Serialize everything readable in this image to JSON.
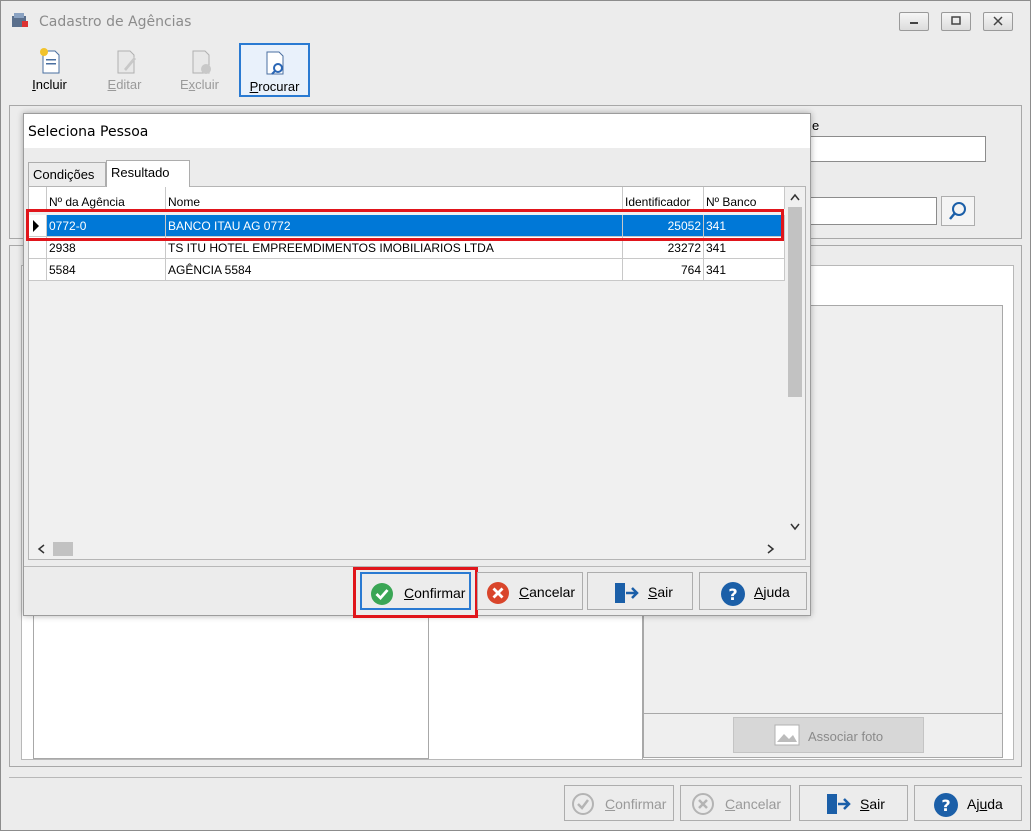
{
  "window": {
    "title": "Cadastro de Agências"
  },
  "toolbar": {
    "incluir": {
      "label_u": "I",
      "label_rest": "ncluir"
    },
    "editar": {
      "label_u": "E",
      "label_rest": "ditar"
    },
    "excluir_pre": "E",
    "excluir_u": "x",
    "excluir_rest": "cluir",
    "procurar": {
      "label_u": "P",
      "label_rest": "rocurar"
    }
  },
  "background_form": {
    "label_fragment": "e",
    "associar_foto": "Associar foto"
  },
  "dialog": {
    "title": "Seleciona Pessoa",
    "tabs": [
      {
        "label": "Condições"
      },
      {
        "label": "Resultado"
      }
    ],
    "columns": [
      "Nº da Agência",
      "Nome",
      "Identificador",
      "Nº Banco"
    ],
    "rows": [
      {
        "agencia": "0772-0",
        "nome": "BANCO ITAU AG 0772",
        "identificador": "25052",
        "banco": "341"
      },
      {
        "agencia": "2938",
        "nome": "TS ITU HOTEL EMPREEMDIMENTOS IMOBILIARIOS LTDA",
        "identificador": "23272",
        "banco": "341"
      },
      {
        "agencia": "5584",
        "nome": "AGÊNCIA 5584",
        "identificador": "764",
        "banco": "341"
      }
    ],
    "buttons": {
      "confirmar": {
        "u": "C",
        "rest": "onfirmar"
      },
      "cancelar": {
        "u": "C",
        "rest": "ancelar"
      },
      "sair": {
        "u": "S",
        "rest": "air"
      },
      "ajuda": {
        "u": "A",
        "rest": "juda"
      }
    }
  },
  "bottom_buttons": {
    "confirmar": {
      "u": "C",
      "rest": "onfirmar"
    },
    "cancelar": {
      "u": "C",
      "rest": "ancelar"
    },
    "sair": {
      "u": "S",
      "rest": "air"
    },
    "ajuda_pre": "Aj",
    "ajuda_u": "u",
    "ajuda_rest": "da"
  },
  "colors": {
    "selection": "#0078d7",
    "highlight_box": "#e0151b",
    "confirm_green": "#3aa655",
    "cancel_red": "#d9452b",
    "help_blue": "#1b5fa8"
  }
}
